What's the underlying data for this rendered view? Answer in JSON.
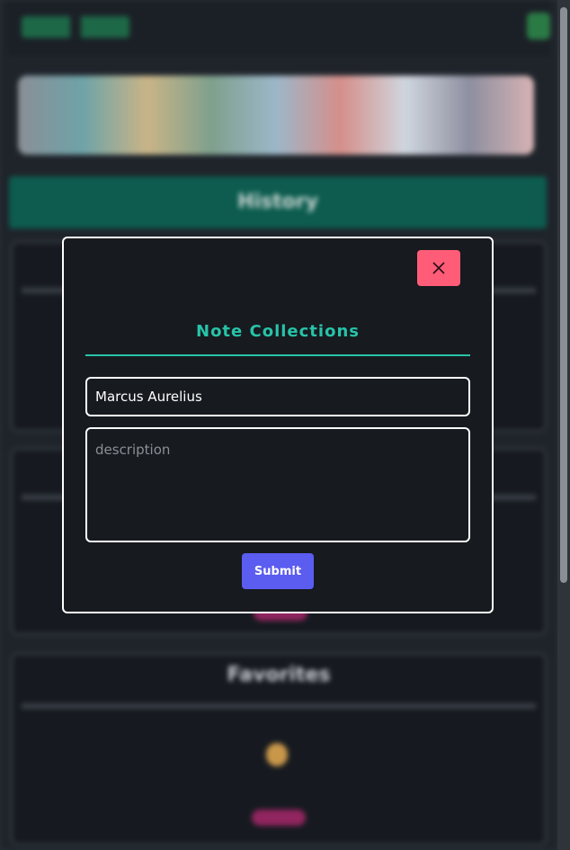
{
  "modal": {
    "title": "Note Collections",
    "close_icon": "close-icon",
    "name_value": "Marcus Aurelius",
    "description_placeholder": "description",
    "submit_label": "Submit"
  },
  "background": {
    "history_label": "History",
    "favorites_label": "Favorites"
  },
  "colors": {
    "accent": "#27c3a8",
    "close_button": "#ff5c78",
    "submit_button": "#5b5cf0",
    "modal_bg": "#171a1f"
  }
}
